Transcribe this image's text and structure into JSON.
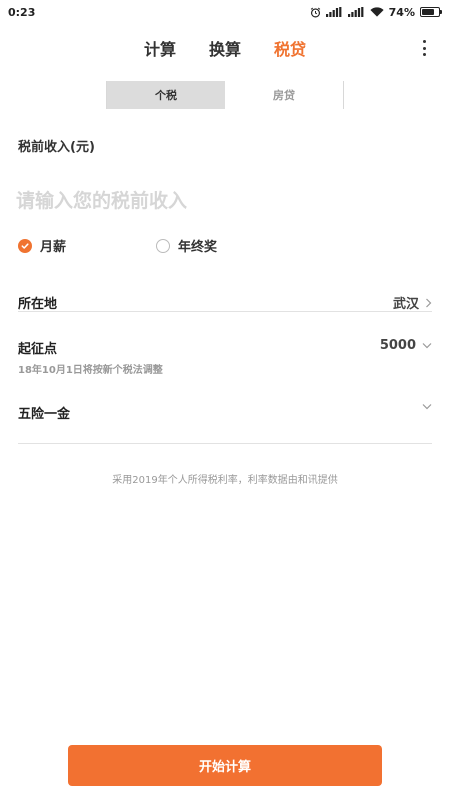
{
  "status_bar": {
    "time": "0:23",
    "battery_text": "74%",
    "battery_level": 0.74,
    "icons": [
      "alarm-icon",
      "signal-icon",
      "signal-icon",
      "wifi-icon",
      "battery-icon"
    ]
  },
  "top_tabs": [
    {
      "label": "计算",
      "active": false
    },
    {
      "label": "换算",
      "active": false
    },
    {
      "label": "税贷",
      "active": true
    }
  ],
  "sub_tabs": [
    {
      "label": "个税",
      "active": true
    },
    {
      "label": "房贷",
      "active": false
    }
  ],
  "income": {
    "label": "税前收入(元)",
    "placeholder": "请输入您的税前收入",
    "value": ""
  },
  "income_type": {
    "monthly_label": "月薪",
    "bonus_label": "年终奖",
    "selected": "monthly"
  },
  "location": {
    "label": "所在地",
    "value": "武汉"
  },
  "threshold": {
    "label": "起征点",
    "note": "18年10月1日将按新个税法调整",
    "value": "5000"
  },
  "insurance": {
    "label": "五险一金",
    "value": ""
  },
  "footnote": "采用2019年个人所得税利率，利率数据由和讯提供",
  "start_button": "开始计算",
  "colors": {
    "accent": "#f07330",
    "placeholder": "#d6d6d6",
    "muted": "#999999"
  }
}
